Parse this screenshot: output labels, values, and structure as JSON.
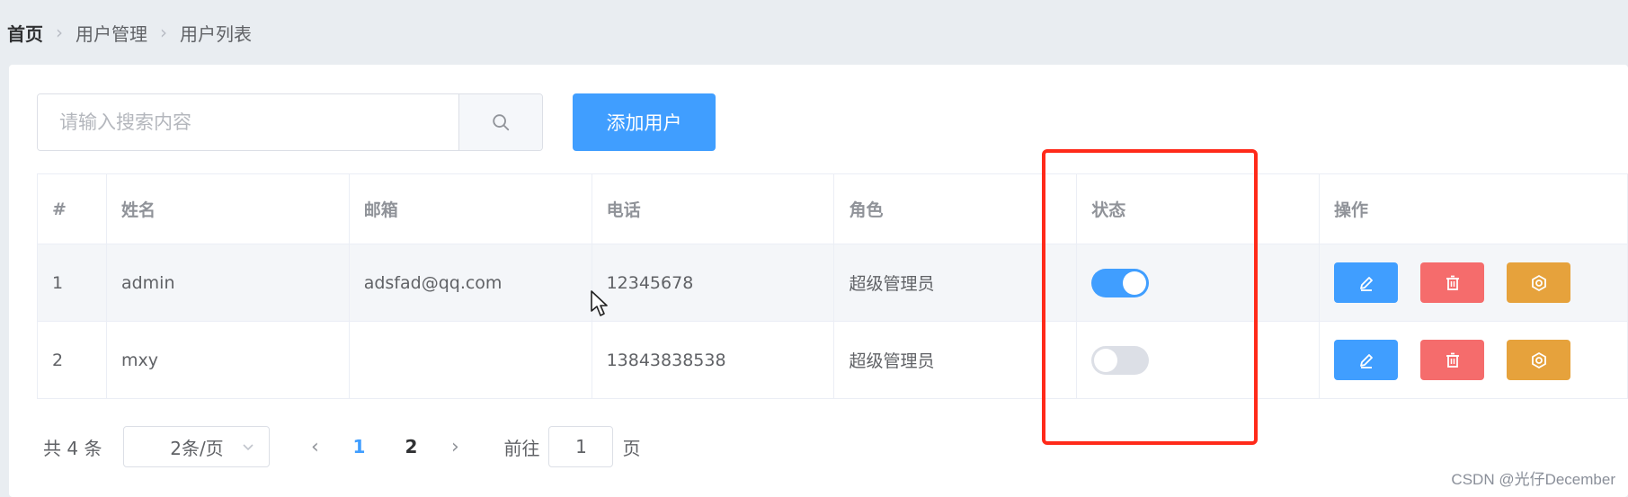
{
  "breadcrumb": [
    "首页",
    "用户管理",
    "用户列表"
  ],
  "search": {
    "placeholder": "请输入搜索内容",
    "value": ""
  },
  "add_button": "添加用户",
  "table": {
    "columns": [
      "#",
      "姓名",
      "邮箱",
      "电话",
      "角色",
      "状态",
      "操作"
    ],
    "rows": [
      {
        "index": "1",
        "name": "admin",
        "email": "adsfad@qq.com",
        "phone": "12345678",
        "role": "超级管理员",
        "status_on": true
      },
      {
        "index": "2",
        "name": "mxy",
        "email": "",
        "phone": "13843838538",
        "role": "超级管理员",
        "status_on": false
      }
    ],
    "actions": [
      "edit-icon",
      "delete-icon",
      "setting-icon"
    ]
  },
  "pagination": {
    "total_text": "共 4 条",
    "page_size": "2条/页",
    "pages": [
      "1",
      "2"
    ],
    "current_page": "1",
    "goto_label": "前往",
    "goto_value": "1",
    "page_unit": "页"
  },
  "watermark": "CSDN @光仔December",
  "colors": {
    "primary": "#409eff",
    "danger": "#f56c6c",
    "warning": "#e6a23c",
    "highlight": "#ff2a1a"
  }
}
